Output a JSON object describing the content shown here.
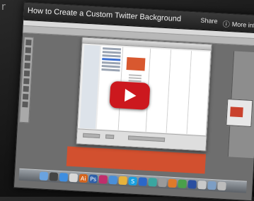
{
  "video": {
    "title": "How to Create a Custom Twitter Background",
    "share_label": "Share",
    "more_info_label": "More info",
    "info_icon": "ⓘ"
  },
  "colors": {
    "accent_red": "#cc181e",
    "canvas_orange": "#d2502f"
  },
  "dock": {
    "icons": [
      {
        "name": "finder-icon",
        "color": "#6aa3e0",
        "glyph": ""
      },
      {
        "name": "dashboard-icon",
        "color": "#444",
        "glyph": ""
      },
      {
        "name": "safari-icon",
        "color": "#3f8ee0",
        "glyph": ""
      },
      {
        "name": "mail-icon",
        "color": "#d7d7d7",
        "glyph": ""
      },
      {
        "name": "illustrator-icon",
        "color": "#d4641e",
        "glyph": "Ai"
      },
      {
        "name": "photoshop-icon",
        "color": "#2e5fa8",
        "glyph": "Ps"
      },
      {
        "name": "indesign-icon",
        "color": "#c02e6b",
        "glyph": ""
      },
      {
        "name": "itunes-icon",
        "color": "#4a8fd8",
        "glyph": ""
      },
      {
        "name": "photos-icon",
        "color": "#e6b23b",
        "glyph": ""
      },
      {
        "name": "skype-icon",
        "color": "#19a0e0",
        "glyph": "S"
      },
      {
        "name": "app-icon-blue",
        "color": "#2b67c8",
        "glyph": ""
      },
      {
        "name": "app-icon-teal",
        "color": "#3aa6a0",
        "glyph": ""
      },
      {
        "name": "app-icon-gray",
        "color": "#9a9a9a",
        "glyph": ""
      },
      {
        "name": "firefox-icon",
        "color": "#e07a2a",
        "glyph": ""
      },
      {
        "name": "chrome-icon",
        "color": "#4aa04a",
        "glyph": ""
      },
      {
        "name": "app-icon-darkblue",
        "color": "#2b4fa0",
        "glyph": ""
      },
      {
        "name": "app-icon-light",
        "color": "#c9c9c9",
        "glyph": ""
      },
      {
        "name": "preview-icon",
        "color": "#7d9ec4",
        "glyph": ""
      },
      {
        "name": "trash-icon",
        "color": "#bcbcbc",
        "glyph": ""
      }
    ]
  }
}
